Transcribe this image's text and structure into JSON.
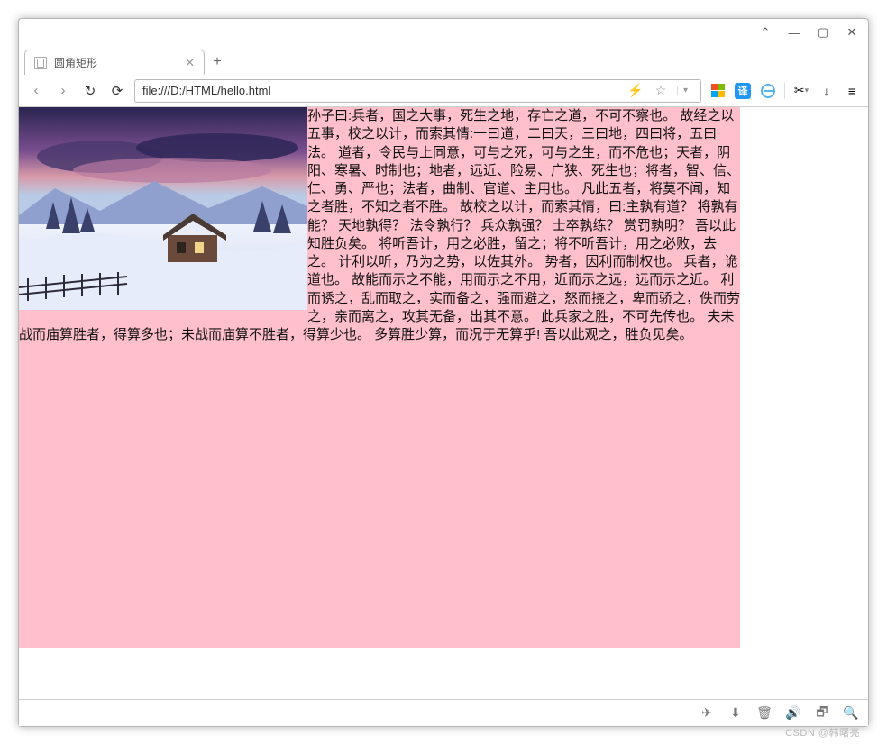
{
  "window": {
    "tab_title": "圆角矩形",
    "new_tab_label": "+",
    "min_label": "—",
    "max_label": "▢",
    "close_label": "✕",
    "collapse_label": "⌃"
  },
  "addressbar": {
    "back": "‹",
    "forward": "›",
    "reload": "↻",
    "home": "⟳",
    "url": "file:///D:/HTML/hello.html",
    "flash": "⚡",
    "star": "☆",
    "dropdown": "▾",
    "translate": "译",
    "scissors": "✂",
    "download": "↓",
    "menu": "≡"
  },
  "page": {
    "bg_color": "#ffc0cb",
    "image_alt": "winter-snow-cabin-landscape",
    "text": "孙子曰:兵者，国之大事，死生之地，存亡之道，不可不察也。 故经之以五事，校之以计，而索其情:一曰道，二曰天，三曰地，四曰将，五曰法。 道者，令民与上同意，可与之死，可与之生，而不危也；天者，阴阳、寒暑、时制也；地者，远近、险易、广狭、死生也；将者，智、信、仁、勇、严也；法者，曲制、官道、主用也。 凡此五者，将莫不闻，知之者胜，不知之者不胜。 故校之以计，而索其情，曰:主孰有道？ 将孰有能？ 天地孰得？ 法令孰行？ 兵众孰强？ 士卒孰练？ 赏罚孰明？ 吾以此知胜负矣。 将听吾计，用之必胜，留之；将不听吾计，用之必败，去之。 计利以听，乃为之势，以佐其外。 势者，因利而制权也。 兵者，诡道也。 故能而示之不能，用而示之不用，近而示之远，远而示之近。 利而诱之，乱而取之，实而备之，强而避之，怒而挠之，卑而骄之，佚而劳之，亲而离之，攻其无备，出其不意。 此兵家之胜，不可先传也。 夫未战而庙算胜者，得算多也；未战而庙算不胜者，得算少也。 多算胜少算，而况于无算乎! 吾以此观之，胜负见矣。"
  },
  "statusbar": {
    "rocket": "🚀",
    "download": "⬇",
    "trash": "🗑",
    "sound": "🔊",
    "restore": "🗗",
    "zoom": "🔍"
  },
  "watermark": "CSDN @韩曙亮"
}
